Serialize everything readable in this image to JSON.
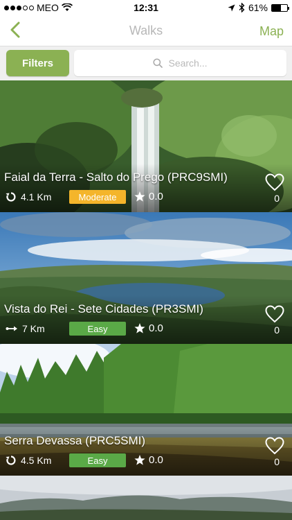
{
  "status": {
    "carrier": "MEO",
    "time": "12:31",
    "battery": "61%",
    "battery_level": 0.61
  },
  "nav": {
    "title": "Walks",
    "map_label": "Map",
    "back_icon": "chevron-left-icon",
    "accent_color": "#8bb153"
  },
  "toolbar": {
    "filters_label": "Filters",
    "search_placeholder": "Search..."
  },
  "walks": [
    {
      "title": "Faial da Terra - Salto do Prego (PRC9SMI)",
      "distance": "4.1 Km",
      "route_icon": "loop-route-icon",
      "difficulty": "Moderate",
      "difficulty_color": "#f4b52b",
      "rating": "0.0",
      "favorites": "0"
    },
    {
      "title": "Vista do Rei - Sete Cidades (PR3SMI)",
      "distance": "7 Km",
      "route_icon": "linear-route-icon",
      "difficulty": "Easy",
      "difficulty_color": "#5aa947",
      "rating": "0.0",
      "favorites": "0"
    },
    {
      "title": "Serra Devassa (PRC5SMI)",
      "distance": "4.5 Km",
      "route_icon": "loop-route-icon",
      "difficulty": "Easy",
      "difficulty_color": "#5aa947",
      "rating": "0.0",
      "favorites": "0"
    }
  ]
}
